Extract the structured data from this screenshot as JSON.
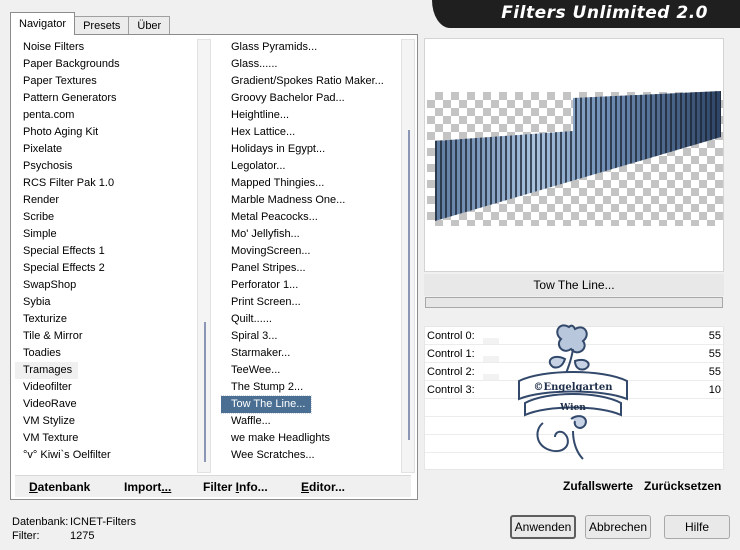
{
  "app": {
    "banner_title": "Filters Unlimited 2.0"
  },
  "tabs": [
    {
      "label": "Navigator",
      "active": true
    },
    {
      "label": "Presets",
      "active": false
    },
    {
      "label": "Über",
      "active": false
    }
  ],
  "categories": {
    "items": [
      "Noise Filters",
      "Paper Backgrounds",
      "Paper Textures",
      "Pattern Generators",
      "penta.com",
      "Photo Aging Kit",
      "Pixelate",
      "Psychosis",
      "RCS Filter Pak 1.0",
      "Render",
      "Scribe",
      "Simple",
      "Special Effects 1",
      "Special Effects 2",
      "SwapShop",
      "Sybia",
      "Texturize",
      "Tile & Mirror",
      "Toadies",
      "Tramages",
      "Videofilter",
      "VideoRave",
      "VM Stylize",
      "VM Texture",
      "°v° Kiwi`s Oelfilter"
    ],
    "highlighted_index": 19
  },
  "filters": {
    "items": [
      "Glass Pyramids...",
      "Glass......",
      "Gradient/Spokes Ratio Maker...",
      "Groovy Bachelor Pad...",
      "Heightline...",
      "Hex Lattice...",
      "Holidays in Egypt...",
      "Legolator...",
      "Mapped Thingies...",
      "Marble Madness One...",
      "Metal Peacocks...",
      "Mo' Jellyfish...",
      "MovingScreen...",
      "Panel Stripes...",
      "Perforator 1...",
      "Print Screen...",
      "Quilt......",
      "Spiral 3...",
      "Starmaker...",
      "TeeWee...",
      "The Stump 2...",
      "Tow The Line...",
      "Waffle...",
      "we make Headlights",
      "Wee Scratches..."
    ],
    "selected_index": 21
  },
  "bottom_buttons": {
    "database": {
      "underlined": "D",
      "rest": "atenbank"
    },
    "import": {
      "prefix": "Import",
      "underlined": "...",
      "rest": ""
    },
    "filter_info": {
      "prefix": "Filter ",
      "underlined": "I",
      "rest": "nfo..."
    },
    "editor": {
      "prefix": "",
      "underlined": "E",
      "rest": "ditor..."
    }
  },
  "preview": {
    "filter_name": "Tow The Line...",
    "progress": 0
  },
  "controls": [
    {
      "label": "Control 0:",
      "value": "55"
    },
    {
      "label": "Control 1:",
      "value": "55"
    },
    {
      "label": "Control 2:",
      "value": "55"
    },
    {
      "label": "Control 3:",
      "value": "10"
    }
  ],
  "watermark": {
    "line1": "©Engelgarten",
    "line2": "Wien"
  },
  "right_buttons": {
    "random": "Zufallswerte",
    "reset": "Zurücksetzen"
  },
  "status": {
    "database_label": "Datenbank:",
    "database_value": "ICNET-Filters",
    "filter_label": "Filter:",
    "filter_value": "1275"
  },
  "dialog_buttons": {
    "apply": "Anwenden",
    "cancel": "Abbrechen",
    "help": "Hilfe"
  },
  "colors": {
    "selection": "#4a6f93",
    "banner": "#1f1f1f",
    "stripe_blue": "#7c9ac0"
  }
}
